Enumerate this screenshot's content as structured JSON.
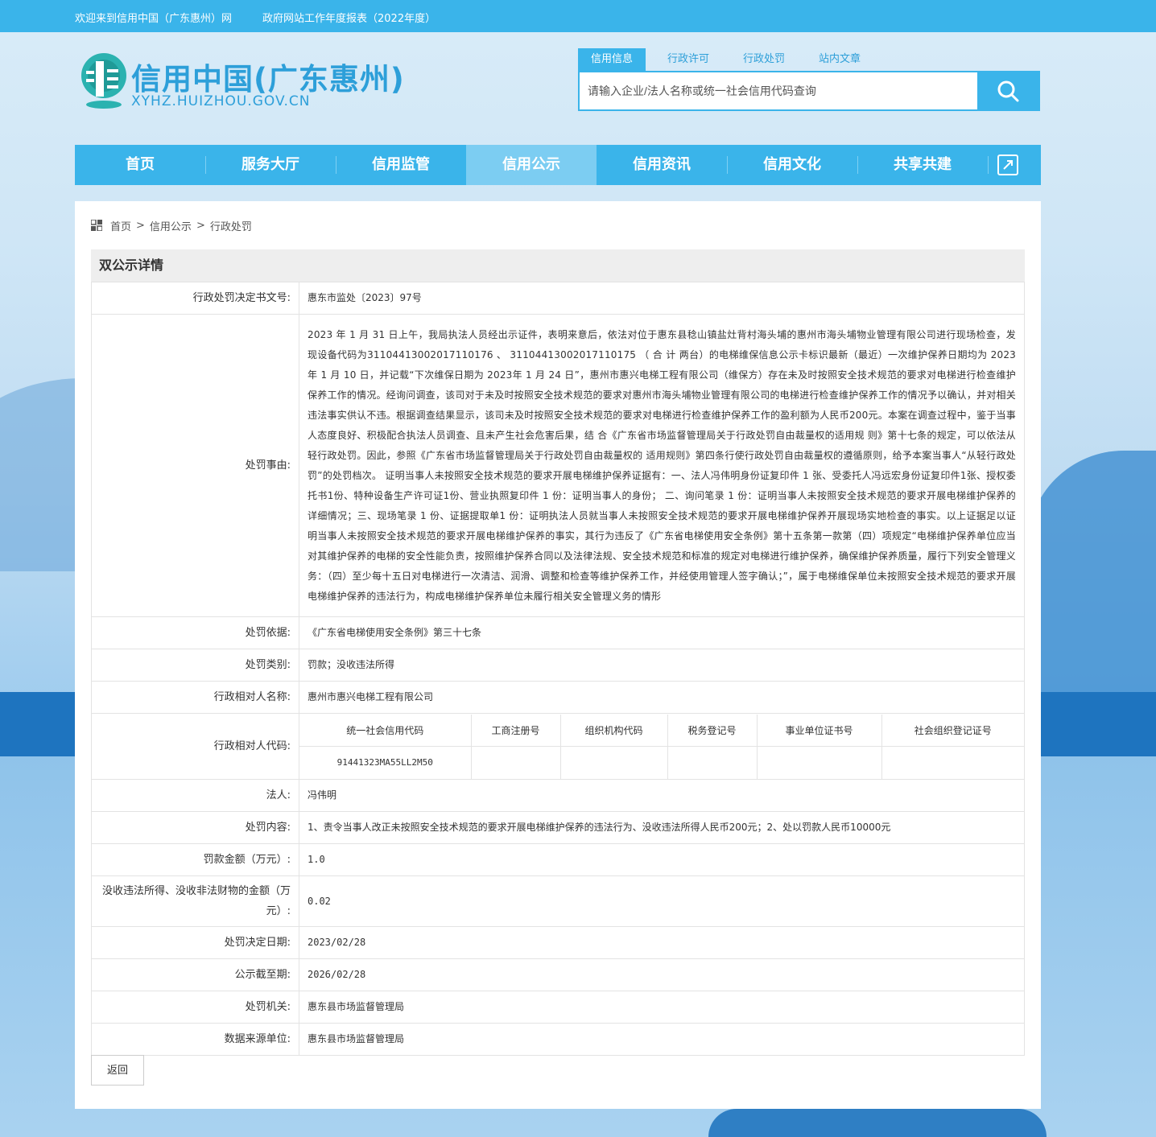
{
  "topbar": {
    "welcome": "欢迎来到信用中国（广东惠州）网",
    "report_link": "政府网站工作年度报表（2022年度）"
  },
  "logo": {
    "title": "信用中国(广东惠州)",
    "url": "XYHZ.HUIZHOU.GOV.CN"
  },
  "search": {
    "tabs": [
      "信用信息",
      "行政许可",
      "行政处罚",
      "站内文章"
    ],
    "active_tab": "信用信息",
    "placeholder": "请输入企业/法人名称或统一社会信用代码查询"
  },
  "nav": {
    "items": [
      "首页",
      "服务大厅",
      "信用监管",
      "信用公示",
      "信用资讯",
      "信用文化",
      "共享共建"
    ],
    "active": "信用公示"
  },
  "breadcrumb": [
    "首页",
    "信用公示",
    "行政处罚"
  ],
  "section_title": "双公示详情",
  "fields": {
    "decision_no": {
      "label": "行政处罚决定书文号:",
      "value": "惠东市监处〔2023〕97号"
    },
    "reason": {
      "label": "处罚事由:",
      "value": "2023 年 1 月 31 日上午，我局执法人员经出示证件，表明来意后，依法对位于惠东县稔山镇盐灶背村海头埔的惠州市海头埔物业管理有限公司进行现场检查，发现设备代码为31104413002017110176 、 31104413002017110175 （ 合 计 两台）的电梯维保信息公示卡标识最新（最近）一次维护保养日期均为 2023 年 1 月 10 日，并记载“下次维保日期为 2023年 1 月 24 日”，惠州市惠兴电梯工程有限公司（维保方）存在未及时按照安全技术规范的要求对电梯进行检查维护保养工作的情况。经询问调查，该司对于未及时按照安全技术规范的要求对惠州市海头埔物业管理有限公司的电梯进行检查维护保养工作的情况予以确认，并对相关违法事实供认不违。根据调查结果显示，该司未及时按照安全技术规范的要求对电梯进行检查维护保养工作的盈利额为人民币200元。本案在调查过程中，鉴于当事人态度良好、积极配合执法人员调查、且未产生社会危害后果，结 合《广东省市场监督管理局关于行政处罚自由裁量权的适用规 则》第十七条的规定，可以依法从轻行政处罚。因此，参照《广东省市场监督管理局关于行政处罚自由裁量权的 适用规则》第四条行使行政处罚自由裁量权的遵循原则，给予本案当事人“从轻行政处罚”的处罚档次。 证明当事人未按照安全技术规范的要求开展电梯维护保养证据有：一、法人冯伟明身份证复印件 1 张、受委托人冯远宏身份证复印件1张、授权委托书1份、特种设备生产许可证1份、营业执照复印件 1 份：证明当事人的身份； 二、询问笔录 1 份：证明当事人未按照安全技术规范的要求开展电梯维护保养的详细情况；三、现场笔录 1 份、证据提取单1 份：证明执法人员就当事人未按照安全技术规范的要求开展电梯维护保养开展现场实地检查的事实。以上证据足以证明当事人未按照安全技术规范的要求开展电梯维护保养的事实，其行为违反了《广东省电梯使用安全条例》第十五条第一款第（四）项规定“电梯维护保养单位应当对其维护保养的电梯的安全性能负责，按照维护保养合同以及法律法规、安全技术规范和标准的规定对电梯进行维护保养，确保维护保养质量，履行下列安全管理义务：（四）至少每十五日对电梯进行一次清洁、润滑、调整和检查等维护保养工作，并经使用管理人签字确认；”，属于电梯维保单位未按照安全技术规范的要求开展电梯维护保养的违法行为，构成电梯维护保养单位未履行相关安全管理义务的情形"
    },
    "basis": {
      "label": "处罚依据:",
      "value": "《广东省电梯使用安全条例》第三十七条"
    },
    "category": {
      "label": "处罚类别:",
      "value": "罚款；没收违法所得"
    },
    "party_name": {
      "label": "行政相对人名称:",
      "value": "惠州市惠兴电梯工程有限公司"
    },
    "party_code": {
      "label": "行政相对人代码:",
      "columns": [
        "统一社会信用代码",
        "工商注册号",
        "组织机构代码",
        "税务登记号",
        "事业单位证书号",
        "社会组织登记证号"
      ],
      "values": [
        "91441323MA55LL2M50",
        "",
        "",
        "",
        "",
        ""
      ]
    },
    "legal_person": {
      "label": "法人:",
      "value": "冯伟明"
    },
    "content": {
      "label": "处罚内容:",
      "value": "1、责令当事人改正未按照安全技术规范的要求开展电梯维护保养的违法行为、没收违法所得人民币200元；2、处以罚款人民币10000元"
    },
    "fine": {
      "label": "罚款金额（万元）:",
      "value": "1.0"
    },
    "confiscation": {
      "label": "没收违法所得、没收非法财物的金额（万元）:",
      "value": "0.02"
    },
    "decision_date": {
      "label": "处罚决定日期:",
      "value": "2023/02/28"
    },
    "publish_until": {
      "label": "公示截至期:",
      "value": "2026/02/28"
    },
    "authority": {
      "label": "处罚机关:",
      "value": "惠东县市场监督管理局"
    },
    "source": {
      "label": "数据来源单位:",
      "value": "惠东县市场监督管理局"
    }
  },
  "back_label": "返回",
  "colors": {
    "primary": "#3ab4ea",
    "active_nav": "#7ccdf2",
    "logo": "#2d9fd9"
  }
}
